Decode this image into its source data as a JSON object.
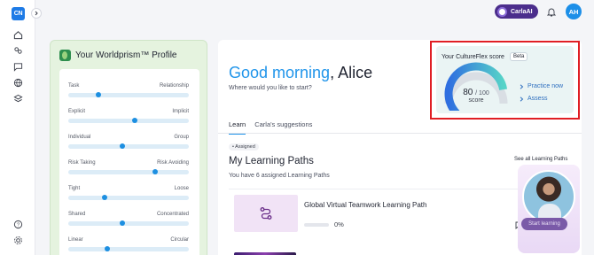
{
  "app": {
    "logo_text": "CN"
  },
  "topbar": {
    "carla_label": "CarlaAI",
    "avatar_initials": "AH"
  },
  "profile": {
    "title": "Your Worldprism™ Profile",
    "dimensions": [
      {
        "left": "Task",
        "right": "Relationship",
        "value": 0.25
      },
      {
        "left": "Explicit",
        "right": "Implicit",
        "value": 0.55
      },
      {
        "left": "Individual",
        "right": "Group",
        "value": 0.45
      },
      {
        "left": "Risk Taking",
        "right": "Risk Avoiding",
        "value": 0.72
      },
      {
        "left": "Tight",
        "right": "Loose",
        "value": 0.3
      },
      {
        "left": "Shared",
        "right": "Concentrated",
        "value": 0.45
      },
      {
        "left": "Linear",
        "right": "Circular",
        "value": 0.32
      }
    ]
  },
  "main": {
    "greeting_highlight": "Good morning",
    "greeting_rest": ", Alice",
    "subtitle": "Where would you like to start?",
    "tabs": [
      {
        "label": "Learn",
        "active": true
      },
      {
        "label": "Carla's suggestions",
        "active": false
      }
    ],
    "assigned_badge": "• Assigned",
    "learning_paths_title": "My Learning Paths",
    "learning_paths_sub": "You have 6 assigned Learning Paths",
    "see_all": "See all Learning Paths",
    "path": {
      "name": "Global Virtual Teamwork Learning Path",
      "progress_text": "0%",
      "progress": 0
    }
  },
  "cultureflex": {
    "title": "Your CultureFlex score",
    "badge": "Beta",
    "score": "80",
    "score_max": "/ 100",
    "score_label": "score",
    "score_value": 80,
    "links": [
      "Practice now",
      "Assess"
    ]
  },
  "carla_panel": {
    "button_label": "Start learning"
  }
}
